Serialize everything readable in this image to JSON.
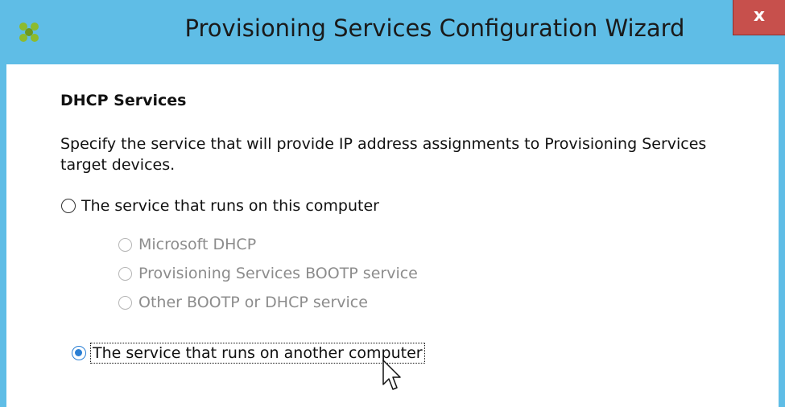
{
  "window": {
    "title": "Provisioning Services Configuration Wizard",
    "close_label": "x"
  },
  "page": {
    "heading": "DHCP Services",
    "description": "Specify the service that will provide IP address assignments to Provisioning Services target devices."
  },
  "options": {
    "this_computer": {
      "label": "The service that runs on this computer",
      "selected": false
    },
    "sub_options": [
      {
        "label": "Microsoft DHCP",
        "enabled": false
      },
      {
        "label": "Provisioning Services BOOTP service",
        "enabled": false
      },
      {
        "label": "Other BOOTP or DHCP service",
        "enabled": false
      }
    ],
    "another_computer": {
      "label": "The service that runs on another computer",
      "selected": true
    }
  },
  "colors": {
    "titlebar": "#5fbde6",
    "close_button": "#c7504c",
    "radio_selected": "#2a7fd4"
  }
}
